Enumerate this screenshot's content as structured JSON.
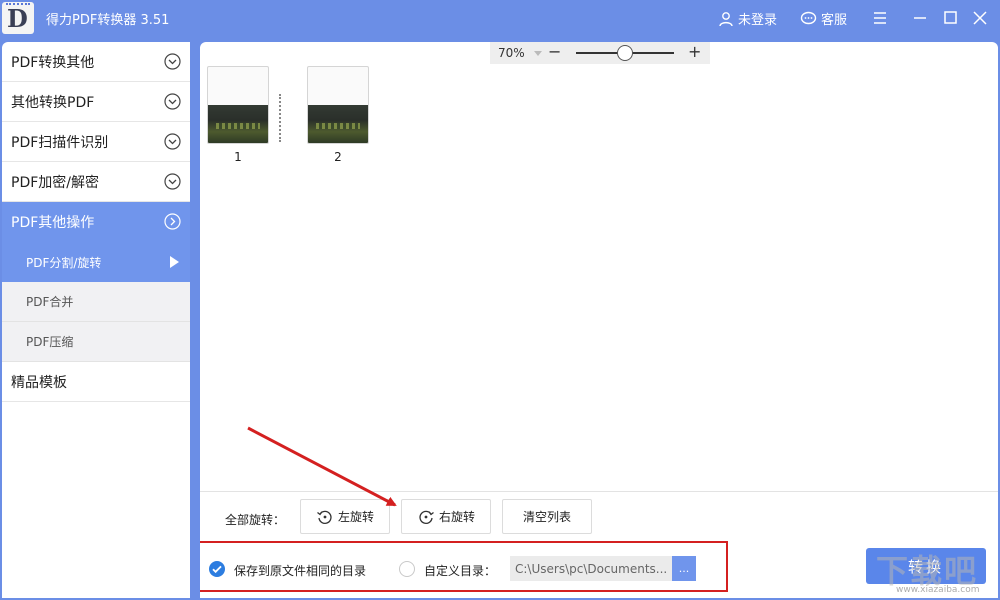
{
  "app": {
    "title": "得力PDF转换器 3.51",
    "logo_letter": "D"
  },
  "titlebar": {
    "login_label": "未登录",
    "service_label": "客服"
  },
  "sidebar": {
    "items": [
      {
        "label": "PDF转换其他"
      },
      {
        "label": "其他转换PDF"
      },
      {
        "label": "PDF扫描件识别"
      },
      {
        "label": "PDF加密/解密"
      },
      {
        "label": "PDF其他操作"
      }
    ],
    "subitems": [
      {
        "label": "PDF分割/旋转"
      },
      {
        "label": "PDF合并"
      },
      {
        "label": "PDF压缩"
      }
    ],
    "templates_label": "精品模板"
  },
  "zoom": {
    "value": "70%",
    "level": 0.5
  },
  "pages": [
    {
      "label": "1"
    },
    {
      "label": "2"
    }
  ],
  "rotate": {
    "label": "全部旋转：",
    "left_label": "左旋转",
    "right_label": "右旋转",
    "clear_label": "清空列表"
  },
  "save": {
    "same_dir_label": "保存到原文件相同的目录",
    "custom_dir_label": "自定义目录：",
    "path_value": "C:\\Users\\pc\\Documents...",
    "browse_label": "..."
  },
  "convert_label": "转换",
  "watermark": {
    "text": "下载吧",
    "sub": "www.xiazaiba.com"
  },
  "colors": {
    "accent": "#6b8ee6",
    "active": "#7095ec",
    "annotation": "#d42020"
  }
}
